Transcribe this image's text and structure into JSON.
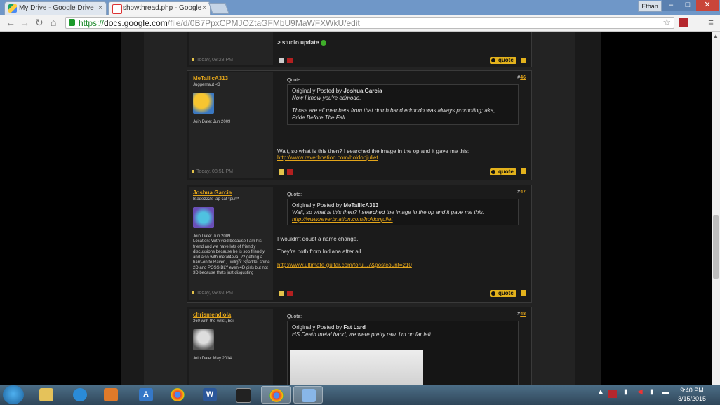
{
  "browser": {
    "tabs": [
      {
        "title": "My Drive - Google Drive",
        "close": "×"
      },
      {
        "title": "showthread.php - Google",
        "close": "×"
      }
    ],
    "profile_name": "Ethan",
    "window_buttons": {
      "minimize": "–",
      "maximize": "□",
      "close": "✕"
    },
    "nav": {
      "back": "←",
      "forward": "→",
      "reload": "↻",
      "home": "⌂"
    },
    "url_protocol": "https://",
    "url_host": "docs.google.com",
    "url_path": "/file/d/0B7PpxCPMJOZtaGFMbU9MaWFXWkU/edit",
    "menu_icon": "≡",
    "star_icon": "☆"
  },
  "colors": {
    "accent": "#e3a51a",
    "quote_button": "#e3b21c",
    "page_bg": "#1b1b1b"
  },
  "top_post": {
    "date": "Today, 08:28 PM",
    "text": "> studio update"
  },
  "posts": [
    {
      "number_prefix": "#",
      "number": "46",
      "username": "MeTallIcA313",
      "user_title": "Juggernaut <3",
      "join_date": "Join Date: Jun 2009",
      "location": "",
      "date": "Today, 08:51 PM",
      "quote_label": "Quote:",
      "quote_intro": "Originally Posted by",
      "quote_author": "Joshua Garcia",
      "quote_lines": [
        "Now I know you're edmodo.",
        "",
        "Those are all members from that dumb band edmodo was always promoting; aka,",
        "Pride Before The Fall."
      ],
      "quote_link": "",
      "body_lines": [
        "Wait, so what is this then? I searched the image in the op and it gave me this:"
      ],
      "body_link": "http://www.reverbnation.com/holdonjuliet",
      "quote_button": "quote"
    },
    {
      "number_prefix": "#",
      "number": "47",
      "username": "Joshua Garcia",
      "user_title": "Bladez22's lap cat *purr*",
      "join_date": "Join Date: Jun 2009",
      "location": "Location: With void because I am his friend and we have lots of friendly discussions because he is soo friendly and also with metal4eva_22 getting a hard-on to Raven, Twilight Sparkle, some 2D and POSSIBLY even 4D girls but not 3D because thats just disgusting",
      "date": "Today, 09:02 PM",
      "quote_label": "Quote:",
      "quote_intro": "Originally Posted by",
      "quote_author": "MeTallIcA313",
      "quote_lines": [
        "Wait, so what is this then? I searched the image in the op and it gave me this:"
      ],
      "quote_link": "http://www.reverbnation.com/holdonjuliet",
      "body_lines": [
        "I wouldn't doubt a name change.",
        "They're both from Indiana after all."
      ],
      "body_link": "http://www.ultimate-guitar.com/foru...7&postcount=210",
      "quote_button": "quote"
    },
    {
      "number_prefix": "#",
      "number": "48",
      "username": "chrismendiola",
      "user_title": "360 with the wrist, boi",
      "join_date": "Join Date: May 2014",
      "quote_label": "Quote:",
      "quote_intro": "Originally Posted by",
      "quote_author": "Fat Lard",
      "quote_lines": [
        "HS Death metal band, we were pretty raw. I'm on far left:"
      ]
    }
  ],
  "taskbar": {
    "apps": [
      "windows-explorer",
      "internet-explorer",
      "media-player",
      "access",
      "chrome",
      "word",
      "steam",
      "chrome",
      "paint"
    ],
    "word_glyph": "W",
    "access_glyph": "A",
    "tray_arrow": "▲",
    "time": "9:40 PM",
    "date": "3/15/2015"
  }
}
